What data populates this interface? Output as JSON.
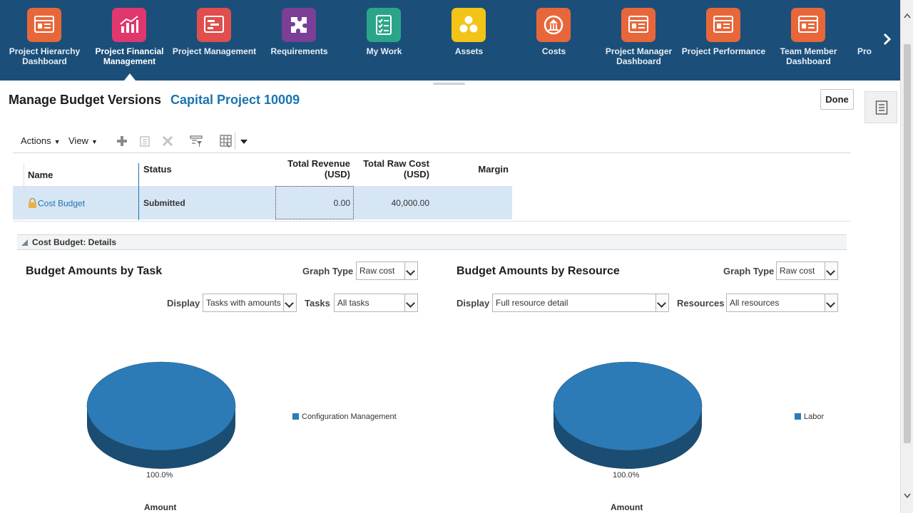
{
  "nav": {
    "items": [
      {
        "label": "Project Hierarchy Dashboard",
        "icon": "dashboard-icon",
        "color": "#e8673a"
      },
      {
        "label": "Project Financial Management",
        "icon": "bar-chart-icon",
        "color": "#e0376e"
      },
      {
        "label": "Project Management",
        "icon": "gantt-icon",
        "color": "#e04e4e"
      },
      {
        "label": "Requirements",
        "icon": "puzzle-icon",
        "color": "#7b3f98"
      },
      {
        "label": "My Work",
        "icon": "checklist-icon",
        "color": "#2ba58a"
      },
      {
        "label": "Assets",
        "icon": "assets-icon",
        "color": "#f2c418"
      },
      {
        "label": "Costs",
        "icon": "costs-icon",
        "color": "#e8673a"
      },
      {
        "label": "Project Manager Dashboard",
        "icon": "dashboard-icon",
        "color": "#e8673a"
      },
      {
        "label": "Project Performance",
        "icon": "dashboard-icon",
        "color": "#e8673a"
      },
      {
        "label": "Team Member Dashboard",
        "icon": "dashboard-icon",
        "color": "#e8673a"
      },
      {
        "label": "Pro",
        "icon": "dashboard-icon",
        "color": "#e8673a"
      }
    ],
    "active": "Project Financial Management"
  },
  "page": {
    "title": "Manage Budget Versions",
    "subtitle": "Capital Project 10009",
    "done_label": "Done"
  },
  "toolbar": {
    "actions_label": "Actions",
    "view_label": "View"
  },
  "table": {
    "headers": {
      "name": "Name",
      "status": "Status",
      "revenue_1": "Total Revenue",
      "revenue_2": "(USD)",
      "raw_cost_1": "Total Raw Cost",
      "raw_cost_2": "(USD)",
      "margin": "Margin"
    },
    "rows": [
      {
        "name": "Cost Budget",
        "status": "Submitted",
        "revenue": "0.00",
        "raw_cost": "40,000.00",
        "margin": ""
      }
    ]
  },
  "details": {
    "header": "Cost Budget: Details",
    "task_panel": {
      "title": "Budget Amounts by Task",
      "graph_type_label": "Graph Type",
      "graph_type_value": "Raw cost",
      "display_label": "Display",
      "display_value": "Tasks with amounts",
      "tasks_label": "Tasks",
      "tasks_value": "All tasks",
      "percent_label": "100.0%",
      "axis_label": "Amount"
    },
    "resource_panel": {
      "title": "Budget Amounts by Resource",
      "graph_type_label": "Graph Type",
      "graph_type_value": "Raw cost",
      "display_label": "Display",
      "display_value": "Full resource detail",
      "resources_label": "Resources",
      "resources_value": "All resources",
      "percent_label": "100.0%",
      "axis_label": "Amount"
    }
  },
  "chart_data": [
    {
      "type": "pie",
      "categories": [
        "Configuration Management"
      ],
      "values": [
        100.0
      ],
      "colors": [
        "#2c7bb6"
      ],
      "xlabel": "Amount"
    },
    {
      "type": "pie",
      "categories": [
        "Labor"
      ],
      "values": [
        100.0
      ],
      "colors": [
        "#2c7bb6"
      ],
      "xlabel": "Amount"
    }
  ]
}
